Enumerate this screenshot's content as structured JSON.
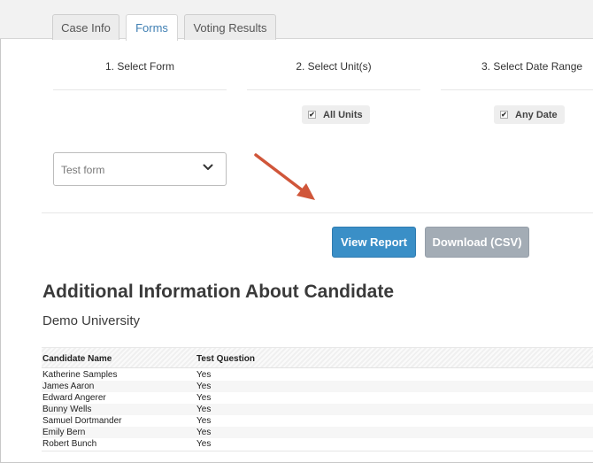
{
  "tabs": [
    {
      "label": "Case Info"
    },
    {
      "label": "Forms"
    },
    {
      "label": "Voting Results"
    }
  ],
  "steps": [
    {
      "title": "1. Select Form"
    },
    {
      "title": "2. Select Unit(s)"
    },
    {
      "title": "3. Select Date Range"
    }
  ],
  "filters": {
    "units_label": "All Units",
    "date_label": "Any Date",
    "check_glyph": "✔"
  },
  "form_select": {
    "value": "Test form"
  },
  "buttons": {
    "view_report": "View Report",
    "download_csv": "Download (CSV)"
  },
  "report": {
    "title": "Additional Information About Candidate",
    "subtitle": "Demo University",
    "columns": [
      "Candidate Name",
      "Test Question"
    ],
    "rows": [
      [
        "Katherine Samples",
        "Yes"
      ],
      [
        "James Aaron",
        "Yes"
      ],
      [
        "Edward Angerer",
        "Yes"
      ],
      [
        "Bunny Wells",
        "Yes"
      ],
      [
        "Samuel Dortmander",
        "Yes"
      ],
      [
        "Emily Bern",
        "Yes"
      ],
      [
        "Robert Bunch",
        "Yes"
      ]
    ]
  },
  "colors": {
    "accent_blue": "#3a8fc7",
    "tab_active_text": "#3f7fb3",
    "button_disabled": "#a3acb5",
    "annotation_arrow": "#d0563a"
  },
  "icons": {
    "dropdown": "chevron-down-icon",
    "annotation": "annotation-arrow"
  }
}
